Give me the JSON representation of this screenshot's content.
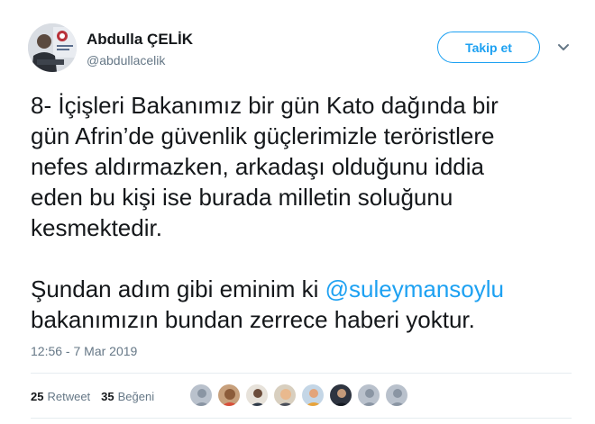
{
  "author": {
    "display_name": "Abdulla ÇELİK",
    "handle": "@abdullacelik"
  },
  "follow_label": "Takip et",
  "tweet": {
    "para1": "8- İçişleri Bakanımız bir gün Kato dağında bir\ngün Afrin’de güvenlik güçlerimizle teröristlere\nnefes aldırmazken, arkadaşı olduğunu iddia\neden bu kişi ise burada milletin soluğunu\nkesmektedir.",
    "para2_before": "Şundan adım gibi eminim ki ",
    "para2_mention": "@suleymansoylu",
    "para2_after": "\nbakanımızın bundan zerrece haberi yoktur."
  },
  "timestamp": "12:56 - 7 Mar 2019",
  "stats": {
    "retweet_count": "25",
    "retweet_label": "Retweet",
    "like_count": "35",
    "like_label": "Beğeni"
  },
  "colors": {
    "accent": "#1da1f2",
    "muted": "#657786",
    "text": "#14171a",
    "divider": "#e6ecf0"
  },
  "icons": {
    "caret": "chevron-down-icon"
  }
}
